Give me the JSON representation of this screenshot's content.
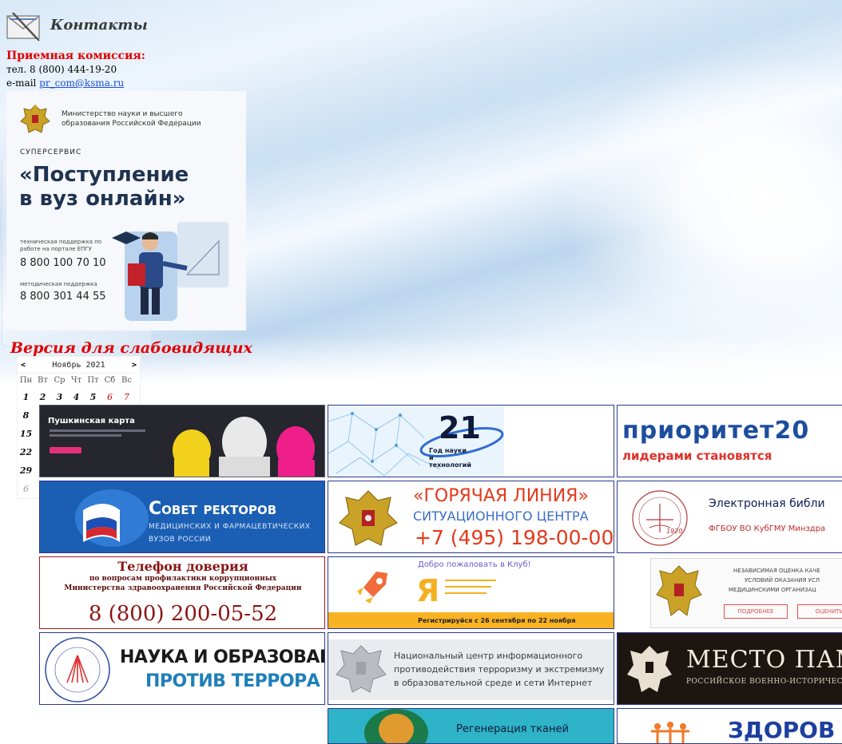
{
  "contacts": {
    "title": "Контакты",
    "admission_label": "Приемная комиссия:",
    "phone_line": "тел. 8 (800) 444-19-20",
    "email_prefix": "e-mail ",
    "email": "pr_com@ksma.ru"
  },
  "superservice": {
    "ministry": "Министерство науки и высшего образования Российской Федерации",
    "label": "СУПЕРСЕРВИС",
    "title_line1": "«Поступление",
    "title_line2": "в вуз онлайн»",
    "tech_support_label": "техническая поддержка по работе на портале ЕПГУ",
    "tech_support_phone": "8 800 100 70 10",
    "method_support_label": "методическая поддержка",
    "method_support_phone": "8 800 301 44 55"
  },
  "accessibility": {
    "low_vision_link": "Версия для слабовидящих"
  },
  "calendar": {
    "prev": "<",
    "next": ">",
    "month": "Ноябрь 2021",
    "weekdays": [
      "Пн",
      "Вт",
      "Ср",
      "Чт",
      "Пт",
      "Сб",
      "Вс"
    ],
    "week1": [
      "1",
      "2",
      "3",
      "4",
      "5",
      "6",
      "7"
    ],
    "week2": [
      "8"
    ],
    "week3": [
      "15"
    ],
    "week4": [
      "22"
    ],
    "week5": [
      "29"
    ],
    "week6": [
      "6"
    ]
  },
  "banners": {
    "pushkin": {
      "title": "Пушкинская карта"
    },
    "year21": {
      "number": "21",
      "caption": "Год науки и технологий"
    },
    "priority": {
      "title": "приоритет20",
      "subtitle": "лидерами становятся"
    },
    "rectors": {
      "title": "Совет ректоров",
      "sub1": "медицинских и фармацевтических",
      "sub2": "вузов России"
    },
    "hotline": {
      "line1": "«ГОРЯЧАЯ ЛИНИЯ»",
      "line2": "СИТУАЦИОННОГО ЦЕНТРА",
      "phone": "+7 (495) 198-00-00"
    },
    "library": {
      "title": "Электронная библи",
      "subtitle": "ФГБОУ ВО КубГМУ Минздра",
      "year": "1920"
    },
    "trust": {
      "title": "Телефон доверия",
      "sub1": "по вопросам профилактики коррупционных",
      "sub2": "Министерства здравоохранения Российской Федерации",
      "phone": "8 (800) 200-05-52"
    },
    "club": {
      "welcome": "Добро пожаловать в Клуб!",
      "logo_letter": "Я",
      "register": "Регистрируйся с 26 сентября по 22 ноября"
    },
    "assess": {
      "line1": "НЕЗАВИСИМАЯ ОЦЕНКА КАЧЕ",
      "line2": "УСЛОВИЙ ОКАЗАНИЯ УСЛ",
      "line3": "МЕДИЦИНСКИМИ ОРГАНИЗАЦ",
      "btn1": "ПОДРОБНЕЕ",
      "btn2": "ОЦЕНИТЬ"
    },
    "science": {
      "line1": "НАУКА И ОБРАЗОВАНИЕ",
      "line2": "ПРОТИВ ТЕРРОРА"
    },
    "national_center": {
      "line1": "Национальный центр информационного",
      "line2": "противодействия терроризму и экстремизму",
      "line3": "в образовательной среде и сети Интернет"
    },
    "memory": {
      "title": "МЕСТО ПАМ",
      "subtitle": "РОССИЙСКОЕ ВОЕННО-ИСТОРИЧЕСКО"
    },
    "regen": {
      "title": "Регенерация тканей"
    },
    "health": {
      "title": "ЗДОРОВ"
    }
  },
  "colors": {
    "accent_red": "#e00000",
    "link_blue": "#1a4fd6",
    "banner_border": "#2c3a8c"
  }
}
